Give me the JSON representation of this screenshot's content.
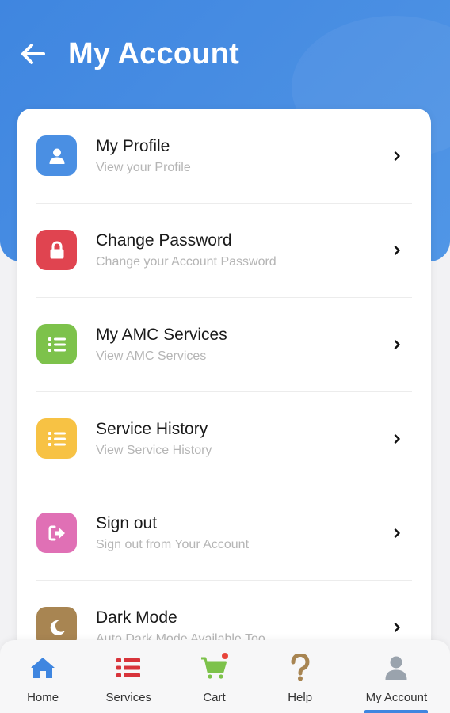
{
  "header": {
    "title": "My Account",
    "background_color": "#4a8fe3",
    "back_icon": "arrow-left-icon"
  },
  "menu": {
    "items": [
      {
        "title": "My Profile",
        "subtitle": "View your Profile",
        "icon": "user-icon",
        "color": "#4a8fe3"
      },
      {
        "title": "Change Password",
        "subtitle": "Change your Account Password",
        "icon": "lock-icon",
        "color": "#e04450"
      },
      {
        "title": "My AMC Services",
        "subtitle": "View AMC Services",
        "icon": "list-icon",
        "color": "#7dc24b"
      },
      {
        "title": "Service History",
        "subtitle": "View Service History",
        "icon": "list-icon",
        "color": "#f7c244"
      },
      {
        "title": "Sign out",
        "subtitle": "Sign out from Your Account",
        "icon": "sign-out-icon",
        "color": "#e070b5"
      },
      {
        "title": "Dark Mode",
        "subtitle": "Auto Dark Mode Available Too",
        "icon": "moon-icon",
        "color": "#a88552"
      }
    ]
  },
  "bottom_nav": {
    "items": [
      {
        "label": "Home",
        "icon": "home-icon",
        "color": "#3f86e0"
      },
      {
        "label": "Services",
        "icon": "list-icon",
        "color": "#d8343b"
      },
      {
        "label": "Cart",
        "icon": "cart-icon",
        "color": "#7dc24b",
        "badge": "dot"
      },
      {
        "label": "Help",
        "icon": "question-icon",
        "color": "#a88552"
      },
      {
        "label": "My Account",
        "icon": "user-icon",
        "color": "#9aa3ad",
        "active": true
      }
    ]
  }
}
